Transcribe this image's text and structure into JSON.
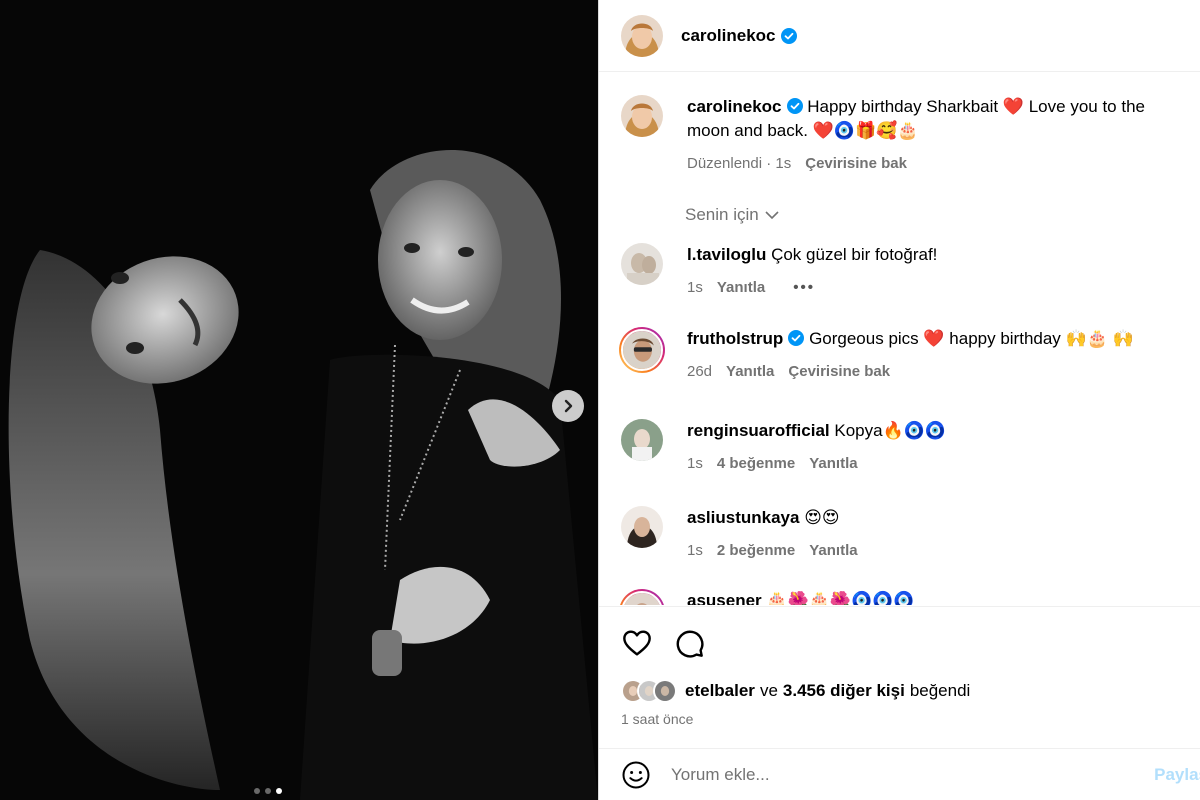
{
  "post": {
    "username": "carolinekoc",
    "carousel": {
      "total": 3,
      "active_index": 0
    }
  },
  "caption": {
    "username": "carolinekoc",
    "text": "Happy birthday Sharkbait ❤️ Love you to the moon and back. ❤️🧿🎁🥰🎂",
    "edited": "Düzenlendi · 1s",
    "translate": "Çevirisine bak"
  },
  "filter": {
    "label": "Senin için"
  },
  "comments": [
    {
      "username": "l.taviloglu",
      "text": "Çok güzel bir fotoğraf!",
      "time": "1s",
      "likes": "",
      "reply": "Yanıtla",
      "translate": "",
      "verified": false,
      "story": false
    },
    {
      "username": "frutholstrup",
      "text": "Gorgeous pics ❤️ happy birthday 🙌🎂 🙌",
      "time": "26d",
      "likes": "",
      "reply": "Yanıtla",
      "translate": "Çevirisine bak",
      "verified": true,
      "story": true
    },
    {
      "username": "renginsuarofficial",
      "text": "Kopya🔥🧿🧿",
      "time": "1s",
      "likes": "4 beğenme",
      "reply": "Yanıtla",
      "translate": "",
      "verified": false,
      "story": false
    },
    {
      "username": "asliustunkaya",
      "text": "😍😍",
      "time": "1s",
      "likes": "2 beğenme",
      "reply": "Yanıtla",
      "translate": "",
      "verified": false,
      "story": false
    },
    {
      "username": "asusener",
      "text": "🎂🌺🎂🌺🧿🧿🧿",
      "time": "",
      "likes": "",
      "reply": "",
      "translate": "",
      "verified": false,
      "story": true
    }
  ],
  "likes": {
    "first_user": "etelbaler",
    "connector": "ve",
    "others": "3.456 diğer kişi",
    "suffix": "beğendi"
  },
  "timeago": "1 saat önce",
  "composer": {
    "placeholder": "Yorum ekle...",
    "post_label": "Paylaş"
  },
  "icons": [
    "chevron-right-icon",
    "heart-icon",
    "comment-icon",
    "emoji-icon",
    "verified-icon",
    "chevron-down-icon",
    "more-icon"
  ],
  "colors": {
    "verified": "#0095f6",
    "muted": "#737373",
    "post_disabled": "#b2dffc",
    "divider": "#efefef"
  }
}
